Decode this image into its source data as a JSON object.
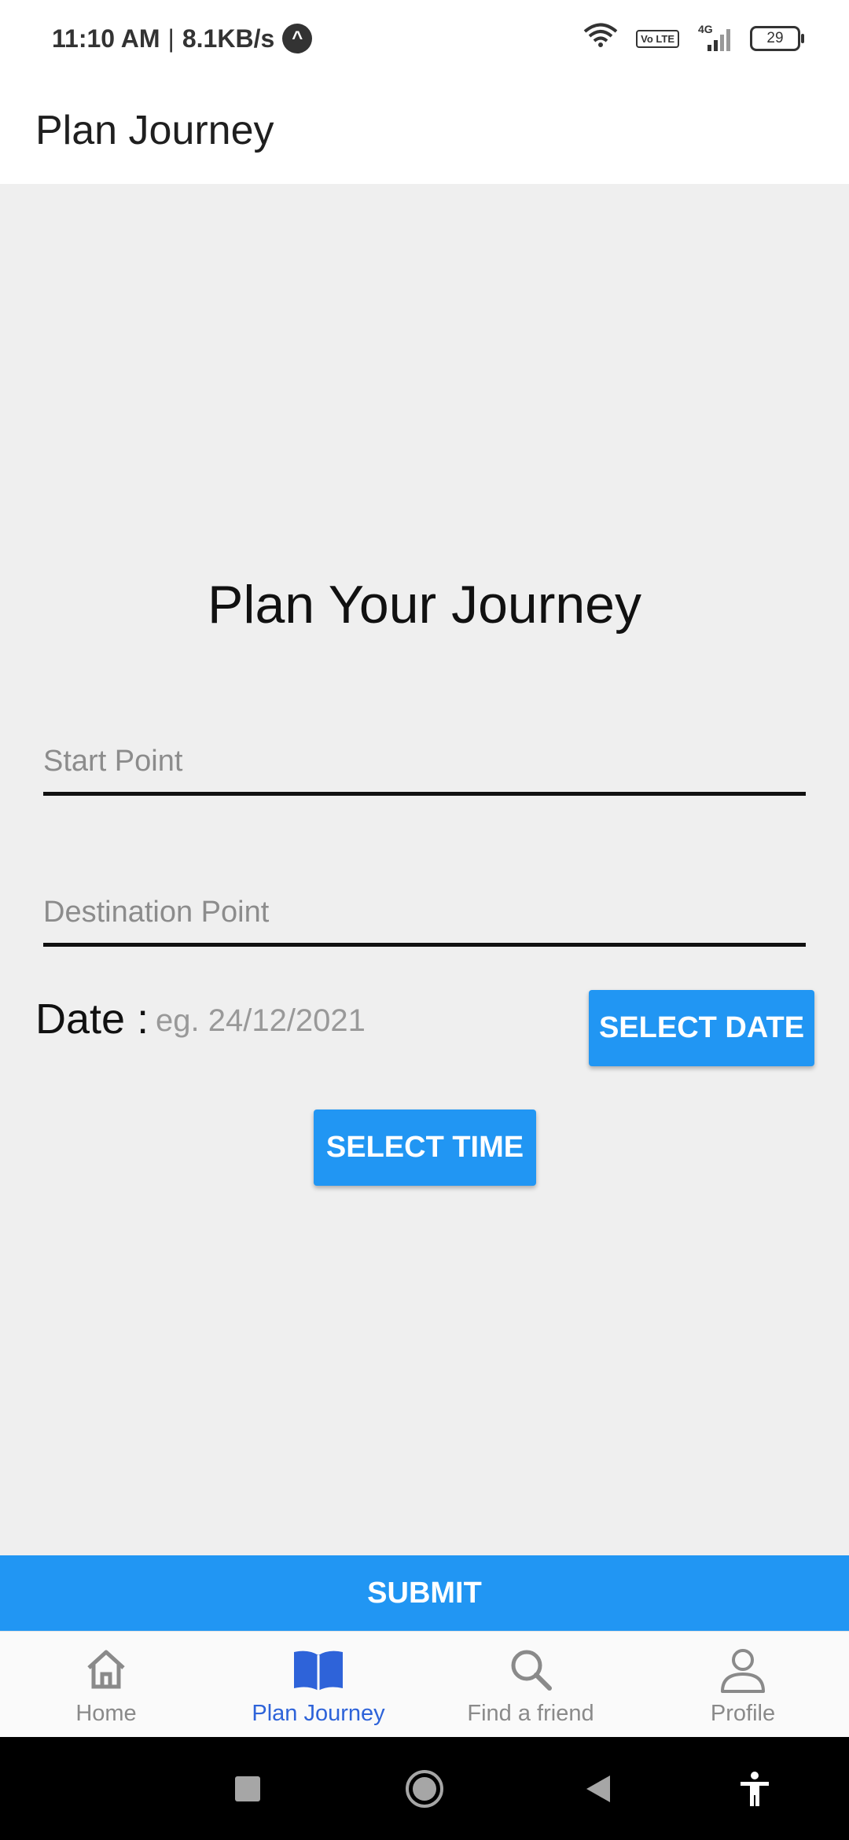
{
  "status_bar": {
    "time": "11:10 AM",
    "separator": "|",
    "net_speed": "8.1KB/s",
    "notification_glyph": "^",
    "network_badge": "Vo LTE",
    "network_type": "4G",
    "battery": "29",
    "icons": [
      "wifi-icon",
      "volte-icon",
      "signal-icon",
      "battery-icon"
    ]
  },
  "header": {
    "title": "Plan Journey"
  },
  "form": {
    "title": "Plan Your Journey",
    "start_placeholder": "Start Point",
    "destination_placeholder": "Destination Point",
    "date_label": "Date :",
    "date_value": "eg. 24/12/2021",
    "select_date_label": "SELECT DATE",
    "select_time_label": "SELECT TIME"
  },
  "submit_label": "SUBMIT",
  "bottom_nav": {
    "items": [
      {
        "label": "Home",
        "icon": "home-icon",
        "active": false
      },
      {
        "label": "Plan Journey",
        "icon": "book-icon",
        "active": true
      },
      {
        "label": "Find a friend",
        "icon": "search-icon",
        "active": false
      },
      {
        "label": "Profile",
        "icon": "person-icon",
        "active": false
      }
    ]
  },
  "system_nav": [
    "recents-icon",
    "home-button-icon",
    "back-icon",
    "accessibility-icon"
  ],
  "colors": {
    "accent": "#2196f3",
    "active_nav": "#2e63d9",
    "inactive_nav": "#8a8a8a",
    "background": "#efefef"
  }
}
